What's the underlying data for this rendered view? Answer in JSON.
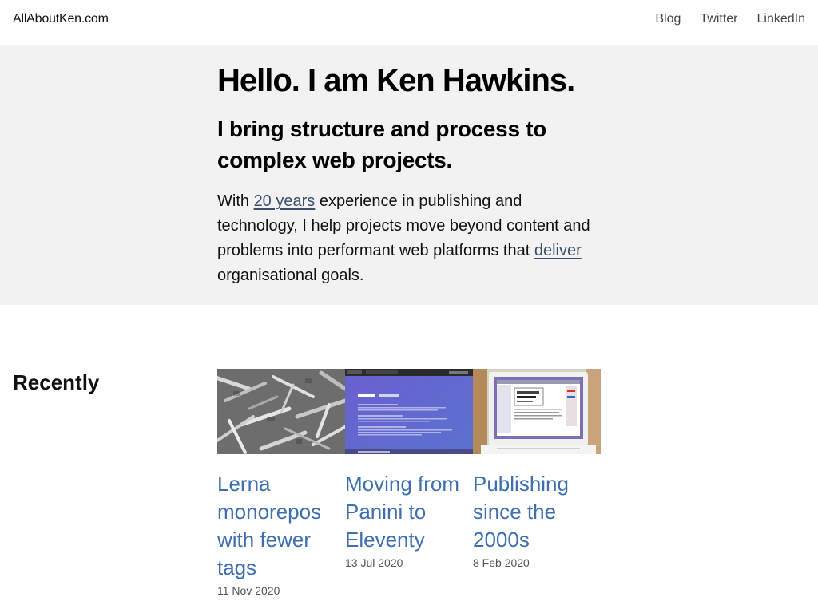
{
  "header": {
    "site_title": "AllAboutKen.com",
    "nav": [
      "Blog",
      "Twitter",
      "LinkedIn"
    ]
  },
  "hero": {
    "heading": "Hello. I am Ken Hawkins.",
    "subheading": "I bring structure and process to complex web projects.",
    "intro": {
      "part1": "With ",
      "link1": "20 years",
      "part2": " experience in publishing and technology, I help projects move beyond content and problems into performant web platforms that ",
      "link2": "deliver",
      "part3": " organisational goals."
    }
  },
  "recently": {
    "heading": "Recently",
    "posts": [
      {
        "title": "Lerna monorepos with fewer tags",
        "date": "11 Nov 2020",
        "thumb": "shredded-paper-photo"
      },
      {
        "title": "Moving from Panini to Eleventy",
        "date": "13 Jul 2020",
        "thumb": "website-screenshot"
      },
      {
        "title": "Publishing since the 2000s",
        "date": "8 Feb 2020",
        "thumb": "old-laptop-photo"
      }
    ]
  }
}
